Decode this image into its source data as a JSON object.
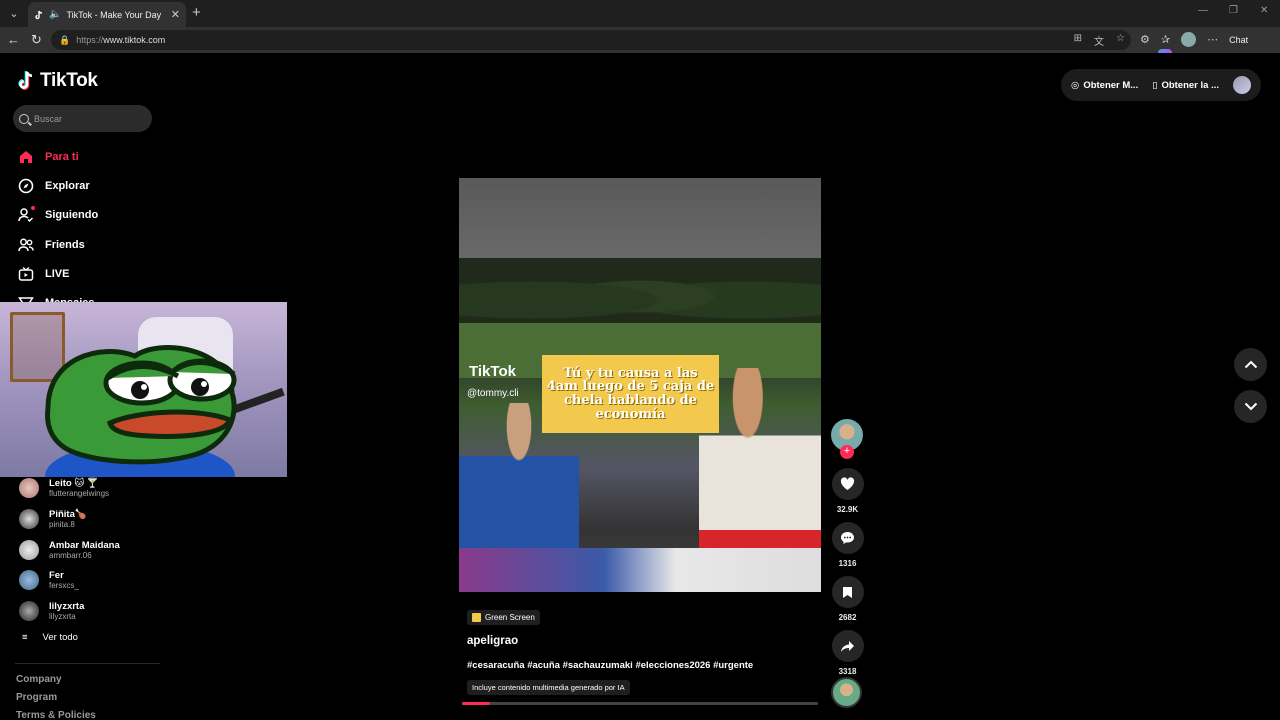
{
  "browser": {
    "tab_title": "TikTok - Make Your Day",
    "url_proto": "https://",
    "url_host": "www.tiktok.com",
    "chat_label": "Chat"
  },
  "app": {
    "logo_text": "TikTok",
    "search_placeholder": "Buscar",
    "menu": [
      {
        "label": "Para ti",
        "icon": "home-icon",
        "active": true
      },
      {
        "label": "Explorar",
        "icon": "compass-icon"
      },
      {
        "label": "Siguiendo",
        "icon": "following-icon"
      },
      {
        "label": "Friends",
        "icon": "friends-icon"
      },
      {
        "label": "LIVE",
        "icon": "live-icon"
      },
      {
        "label": "Mensajes",
        "icon": "messages-icon"
      }
    ],
    "following_accounts": [
      {
        "name": "Leito 🐱 🍸",
        "user": "flutterangelwings"
      },
      {
        "name": "Piñita🍗",
        "user": "pinita.8"
      },
      {
        "name": "Ambar Maidana",
        "user": "ammbarr.06"
      },
      {
        "name": "Fer",
        "user": "fersxcs_"
      },
      {
        "name": "lilyzxrta",
        "user": "lilyzxrta"
      }
    ],
    "see_all": "Ver todo",
    "footer": [
      "Company",
      "Program",
      "Terms & Policies"
    ],
    "top_buttons": {
      "get_coins": "Obtener M...",
      "get_app": "Obtener la ..."
    }
  },
  "video": {
    "caption": "Tú y tu causa a las 4am luego de 5 caja de chela hablando de economía",
    "watermark": "TikTok",
    "handle_overlay": "@tommy.cli",
    "effect_tag": "Green Screen",
    "username": "apeligrao",
    "hashtags": "#cesaracuña #acuña #sachauzumaki #elecciones2026 #urgente",
    "ai_label": "Incluye contenido multimedia generado por IA",
    "progress": 0.08,
    "likes": "32.9K",
    "comments": "1316",
    "saves": "2682",
    "shares": "3318"
  },
  "colors": {
    "accent": "#fe2c55",
    "background": "#000000"
  }
}
